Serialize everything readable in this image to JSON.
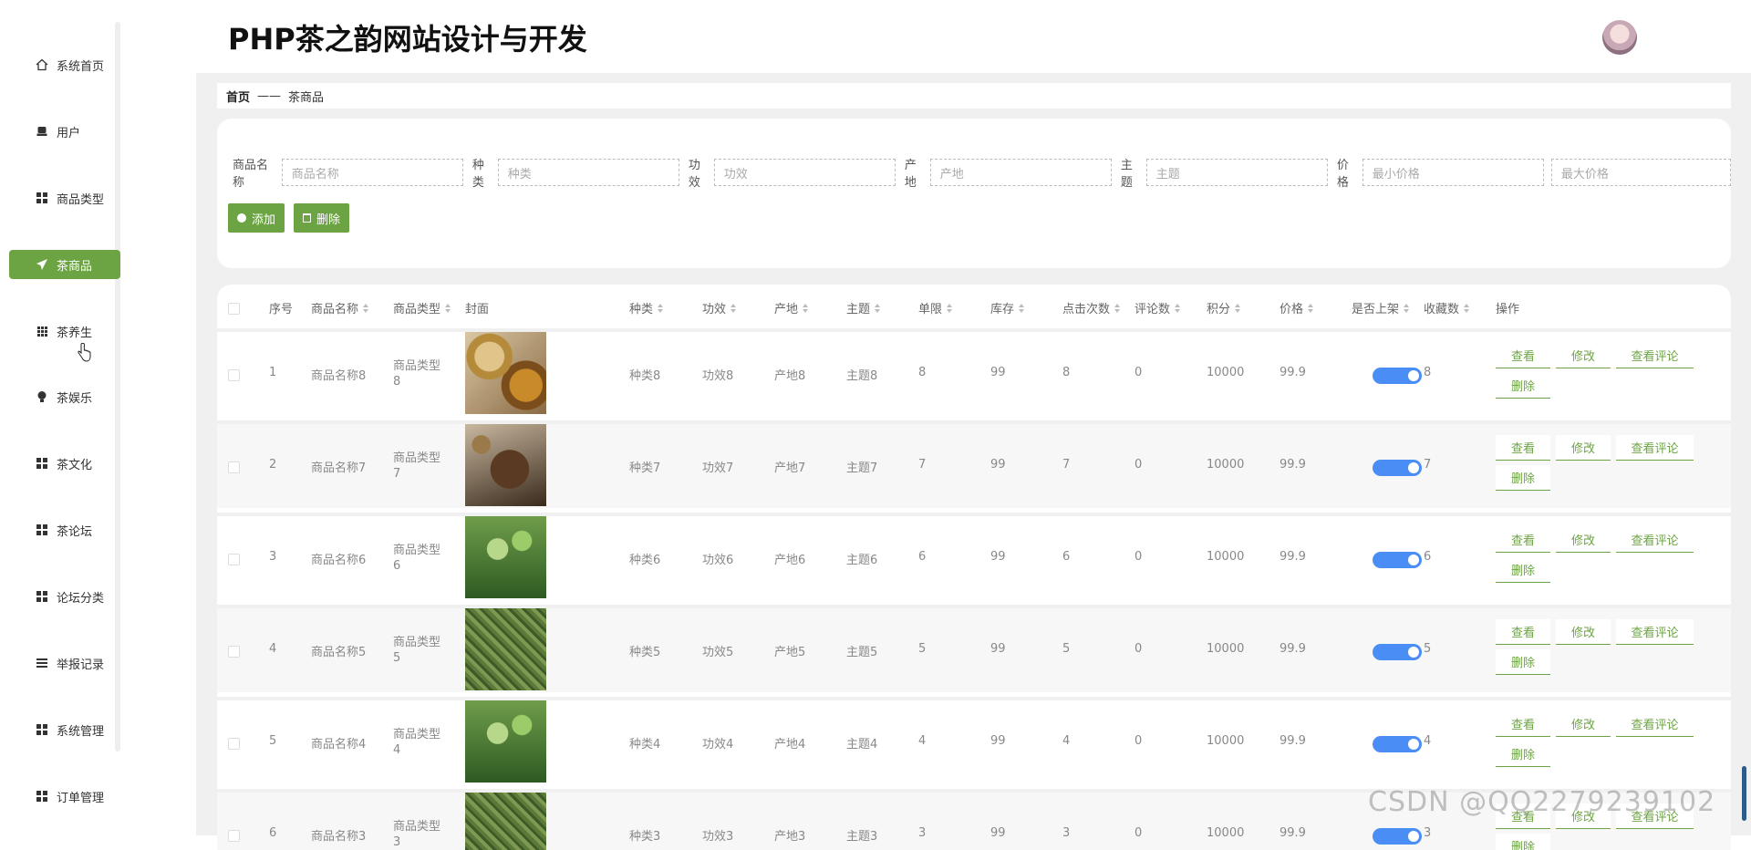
{
  "app_title": "PHP茶之韵网站设计与开发",
  "sidebar": {
    "items": [
      {
        "label": "系统首页",
        "icon": "home-icon"
      },
      {
        "label": "用户",
        "icon": "user-icon"
      },
      {
        "label": "商品类型",
        "icon": "grid-icon"
      },
      {
        "label": "茶商品",
        "icon": "paper-plane-icon",
        "active": true
      },
      {
        "label": "茶养生",
        "icon": "grid9-icon"
      },
      {
        "label": "茶娱乐",
        "icon": "bulb-icon"
      },
      {
        "label": "茶文化",
        "icon": "grid-icon"
      },
      {
        "label": "茶论坛",
        "icon": "grid-icon"
      },
      {
        "label": "论坛分类",
        "icon": "grid-icon"
      },
      {
        "label": "举报记录",
        "icon": "list-icon"
      },
      {
        "label": "系统管理",
        "icon": "grid-icon"
      },
      {
        "label": "订单管理",
        "icon": "grid-icon"
      }
    ]
  },
  "breadcrumb": {
    "home": "首页",
    "sep": "——",
    "current": "茶商品"
  },
  "search": {
    "name_label": "商品名称",
    "name_placeholder": "商品名称",
    "type_label": "种类",
    "type_placeholder": "种类",
    "effect_label": "功效",
    "effect_placeholder": "功效",
    "origin_label": "产地",
    "origin_placeholder": "产地",
    "theme_label": "主题",
    "theme_placeholder": "主题",
    "price_label": "价格",
    "min_price_placeholder": "最小价格",
    "max_price_placeholder": "最大价格"
  },
  "actions": {
    "add_label": "添加",
    "delete_label": "删除"
  },
  "table": {
    "headers": {
      "index": "序号",
      "name": "商品名称",
      "category": "商品类型",
      "cover": "封面",
      "kind": "种类",
      "effect": "功效",
      "origin": "产地",
      "theme": "主题",
      "limit": "单限",
      "stock": "库存",
      "clicks": "点击次数",
      "comments": "评论数",
      "points": "积分",
      "price": "价格",
      "on_shelf": "是否上架",
      "favorites": "收藏数",
      "ops": "操作"
    },
    "op_labels": {
      "view": "查看",
      "edit": "修改",
      "view_comments": "查看评论",
      "delete": "删除"
    },
    "rows": [
      {
        "index": "1",
        "name": "商品名称8",
        "category1": "商品类型",
        "category2": "8",
        "kind": "种类8",
        "effect": "功效8",
        "origin": "产地8",
        "theme": "主题8",
        "limit": "8",
        "stock": "99",
        "clicks": "8",
        "comments": "0",
        "points": "10000",
        "price": "99.9",
        "favorites": "8"
      },
      {
        "index": "2",
        "name": "商品名称7",
        "category1": "商品类型",
        "category2": "7",
        "kind": "种类7",
        "effect": "功效7",
        "origin": "产地7",
        "theme": "主题7",
        "limit": "7",
        "stock": "99",
        "clicks": "7",
        "comments": "0",
        "points": "10000",
        "price": "99.9",
        "favorites": "7"
      },
      {
        "index": "3",
        "name": "商品名称6",
        "category1": "商品类型",
        "category2": "6",
        "kind": "种类6",
        "effect": "功效6",
        "origin": "产地6",
        "theme": "主题6",
        "limit": "6",
        "stock": "99",
        "clicks": "6",
        "comments": "0",
        "points": "10000",
        "price": "99.9",
        "favorites": "6"
      },
      {
        "index": "4",
        "name": "商品名称5",
        "category1": "商品类型",
        "category2": "5",
        "kind": "种类5",
        "effect": "功效5",
        "origin": "产地5",
        "theme": "主题5",
        "limit": "5",
        "stock": "99",
        "clicks": "5",
        "comments": "0",
        "points": "10000",
        "price": "99.9",
        "favorites": "5"
      },
      {
        "index": "5",
        "name": "商品名称4",
        "category1": "商品类型",
        "category2": "4",
        "kind": "种类4",
        "effect": "功效4",
        "origin": "产地4",
        "theme": "主题4",
        "limit": "4",
        "stock": "99",
        "clicks": "4",
        "comments": "0",
        "points": "10000",
        "price": "99.9",
        "favorites": "4"
      },
      {
        "index": "6",
        "name": "商品名称3",
        "category1": "商品类型",
        "category2": "3",
        "kind": "种类3",
        "effect": "功效3",
        "origin": "产地3",
        "theme": "主题3",
        "limit": "3",
        "stock": "99",
        "clicks": "3",
        "comments": "0",
        "points": "10000",
        "price": "99.9",
        "favorites": "3"
      }
    ]
  },
  "watermark": "CSDN @QQ2279239102",
  "colors": {
    "accent": "#6ca443",
    "toggle": "#4a8ef5"
  }
}
